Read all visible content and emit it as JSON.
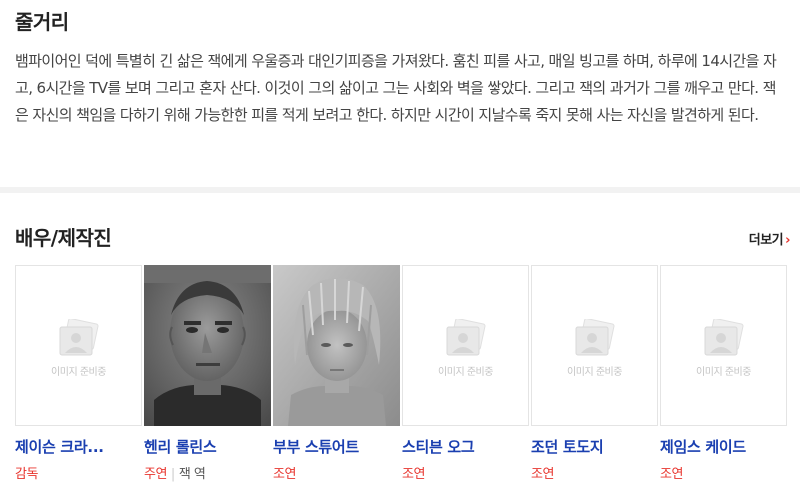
{
  "synopsis": {
    "title": "줄거리",
    "text": "뱀파이어인 덕에 특별히 긴 삶은 잭에게 우울증과 대인기피증을 가져왔다. 훔친 피를 사고, 매일 빙고를 하며, 하루에 14시간을 자고, 6시간을 TV를 보며 그리고 혼자 산다. 이것이 그의 삶이고 그는 사회와 벽을 쌓았다. 그리고 잭의 과거가 그를 깨우고 만다. 잭은 자신의 책임을 다하기 위해 가능한한 피를 적게 보려고 한다. 하지만 시간이 지날수록 죽지 못해 사는 자신을 발견하게 된다."
  },
  "cast": {
    "title": "배우/제작진",
    "more_label": "더보기",
    "more_icon": "chevron-right-icon",
    "accent_color": "#e8352e",
    "link_color": "#1a3fb0",
    "placeholder_text": "이미지 준비중",
    "members": [
      {
        "name": "제이슨 크라...",
        "role": "감독",
        "character": "",
        "photo": "placeholder"
      },
      {
        "name": "헨리 롤린스",
        "role": "주연",
        "character": "잭 역",
        "photo": "portrait-man"
      },
      {
        "name": "부부 스튜어트",
        "role": "조연",
        "character": "",
        "photo": "portrait-child"
      },
      {
        "name": "스티븐 오그",
        "role": "조연",
        "character": "",
        "photo": "placeholder"
      },
      {
        "name": "조던 토도지",
        "role": "조연",
        "character": "",
        "photo": "placeholder"
      },
      {
        "name": "제임스 케이드",
        "role": "조연",
        "character": "",
        "photo": "placeholder"
      }
    ]
  }
}
